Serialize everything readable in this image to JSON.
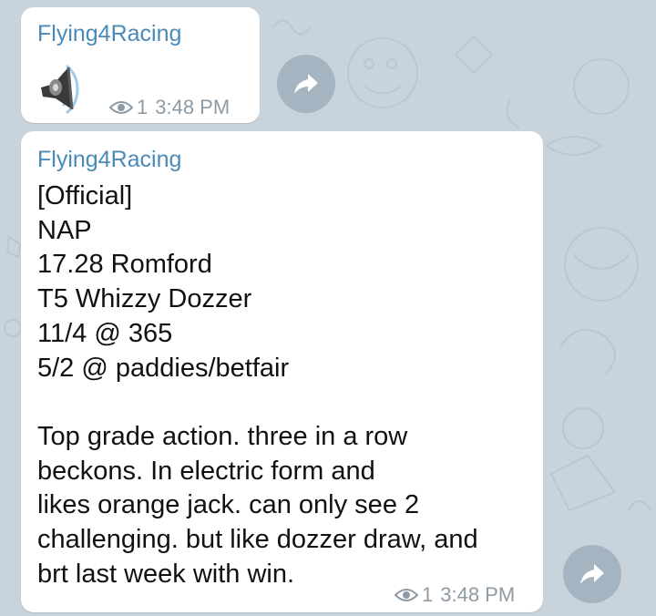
{
  "chat": {
    "messages": [
      {
        "sender": "Flying4Racing",
        "attachment_icon": "speaker-icon",
        "views": "1",
        "time": "3:48 PM"
      },
      {
        "sender": "Flying4Racing",
        "text": "[Official]\nNAP\n17.28 Romford\nT5 Whizzy Dozzer\n11/4 @ 365\n5/2 @ paddies/betfair\n\nTop grade action. three in a row\nbeckons. In electric form and\nlikes orange jack. can only see 2\nchallenging. but like dozzer draw, and\nbrt last week with win.",
        "views": "1",
        "time": "3:48 PM"
      }
    ]
  },
  "icons": {
    "views": "eye-icon",
    "forward": "share-arrow-icon",
    "attachment": "speaker-icon"
  },
  "colors": {
    "background": "#c9d3dc",
    "sender": "#4a8ab8",
    "forward_button": "#a4b4c1",
    "meta": "#8e9aa4"
  }
}
